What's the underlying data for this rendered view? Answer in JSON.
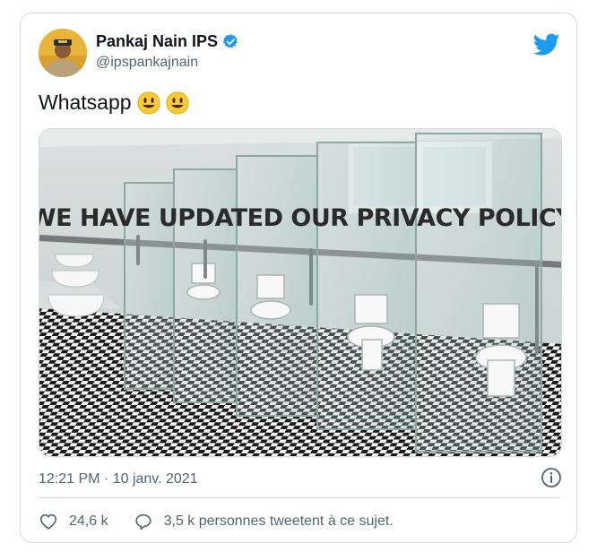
{
  "author": {
    "name": "Pankaj Nain IPS",
    "handle": "@ipspankajnain",
    "verified": true
  },
  "tweet": {
    "text": "Whatsapp",
    "emojis": [
      "smiling-face-icon",
      "smiling-face-icon"
    ]
  },
  "media": {
    "caption": "“WE HAVE UPDATED OUR PRIVACY POLICY”",
    "description_icon": "photo"
  },
  "meta": {
    "timestamp": "12:21 PM · 10 janv. 2021"
  },
  "actions": {
    "likes": "24,6 k",
    "conversation": "3,5 k personnes tweetent à ce sujet."
  },
  "colors": {
    "twitter_blue": "#1d9bf0",
    "muted_text": "#536471",
    "border": "#cfd9de",
    "emoji_yellow": "#ffcc33"
  }
}
